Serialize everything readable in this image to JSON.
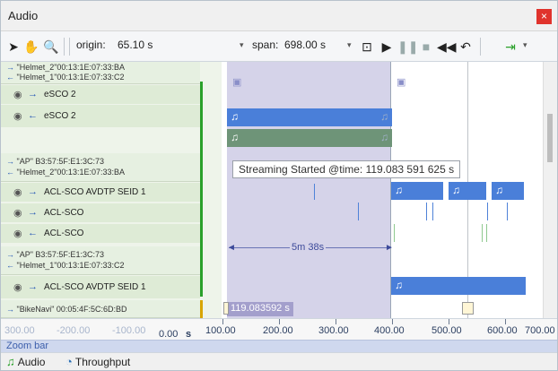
{
  "window": {
    "title": "Audio",
    "close_glyph": "×"
  },
  "toolbar": {
    "origin_label": "origin:",
    "origin_value": "65.10 s",
    "span_label": "span:",
    "span_value": "698.00 s",
    "dropdown_glyph": "▾"
  },
  "groups": [
    {
      "line1": "\"Helmet_2\"00:13:1E:07:33:BA",
      "line2": "\"Helmet_1\"00:13:1E:07:33:C2",
      "rows": [
        {
          "dir": "→",
          "label": "eSCO 2"
        },
        {
          "dir": "←",
          "label": "eSCO 2"
        }
      ]
    },
    {
      "line1": "\"AP\" B3:57:5F:E1:3C:73",
      "line2": "\"Helmet_2\"00:13:1E:07:33:BA",
      "rows": [
        {
          "dir": "→",
          "label": "ACL-SCO AVDTP SEID 1"
        },
        {
          "dir": "→",
          "label": "ACL-SCO"
        },
        {
          "dir": "←",
          "label": "ACL-SCO"
        }
      ]
    },
    {
      "line1": "\"AP\" B3:57:5F:E1:3C:73",
      "line2": "\"Helmet_1\"00:13:1E:07:33:C2",
      "rows": [
        {
          "dir": "→",
          "label": "ACL-SCO AVDTP SEID 1"
        }
      ]
    },
    {
      "line1": "\"BikeNavi\" 00:05:4F:5C:6D:BD"
    }
  ],
  "tooltip": "Streaming Started  @time: 119.083 591 625 s",
  "measure_label": "5m 38s",
  "cursor_time": "119.083592 s",
  "ruler": {
    "faint_labels": [
      "300.00",
      "-200.00",
      "-100.00"
    ],
    "zero": "0.00",
    "unit": "s",
    "labels": [
      "100.00",
      "200.00",
      "300.00",
      "400.00",
      "500.00",
      "600.00",
      "700.00"
    ]
  },
  "zoom_bar": "Zoom bar",
  "tabs": [
    {
      "label": "Audio",
      "icon": "music-note-icon"
    },
    {
      "label": "Throughput",
      "icon": "gauge-icon"
    }
  ],
  "colors": {
    "selection": "#d5d3e9",
    "stream_blue": "#4a7fd9",
    "stream_green": "#6e9478"
  }
}
